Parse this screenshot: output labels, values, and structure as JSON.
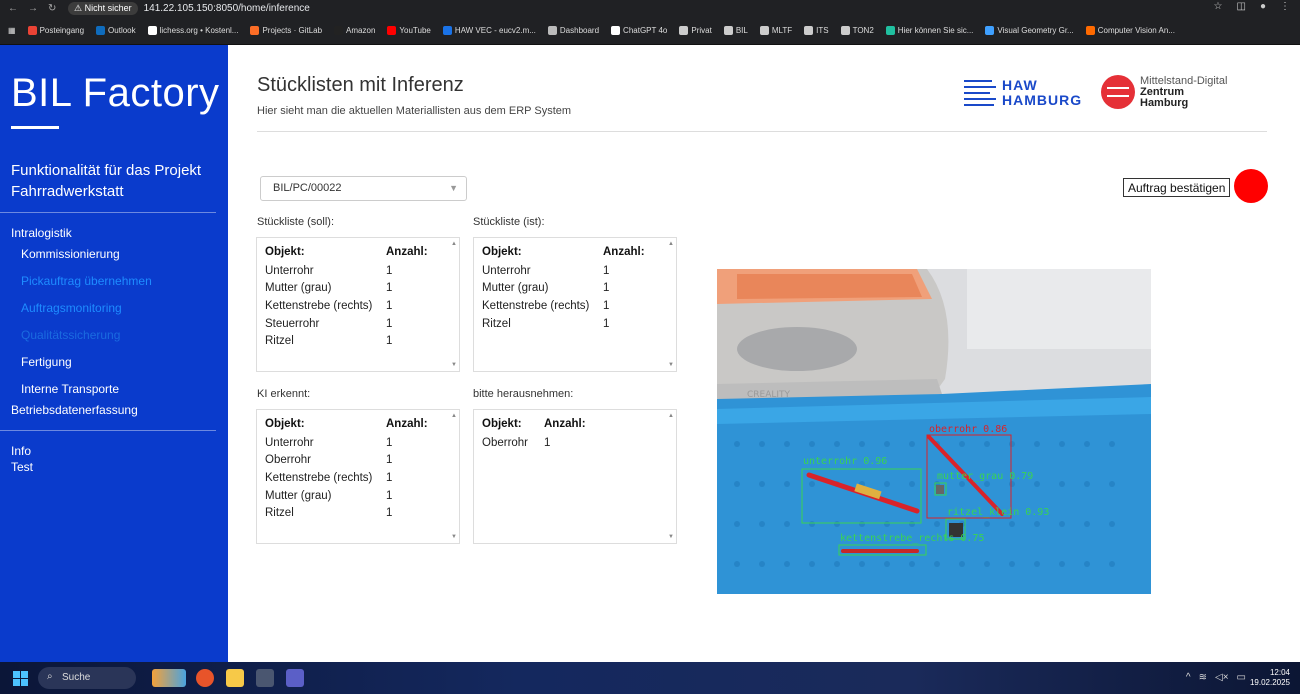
{
  "browser": {
    "security_badge": "⚠ Nicht sicher",
    "url": "141.22.105.150:8050/home/inference",
    "bookmarks": [
      "Posteingang",
      "Outlook",
      "lichess.org • Kostenl...",
      "Projects · GitLab",
      "Amazon",
      "YouTube",
      "HAW VEC - eucv2.m...",
      "Dashboard",
      "ChatGPT 4o",
      "Privat",
      "BIL",
      "MLTF",
      "ITS",
      "TON2",
      "Hier können Sie sic...",
      "Visual Geometry Gr...",
      "Computer Vision An..."
    ],
    "bookmark_colors": [
      "#ea4335",
      "#0f6cbd",
      "#ffffff",
      "#fc6d26",
      "#222222",
      "#ff0000",
      "#1a73e8",
      "#bbbbbb",
      "#ffffff",
      "#cccccc",
      "#cccccc",
      "#cccccc",
      "#cccccc",
      "#cccccc",
      "#20c0a0",
      "#3fa0ff",
      "#ff6a00"
    ]
  },
  "sidebar": {
    "brand": "BIL Factory",
    "project": "Funktionalität für das Projekt Fahrradwerkstatt",
    "items": [
      {
        "label": "Intralogistik",
        "level": 0,
        "style": "normal"
      },
      {
        "label": "Kommissionierung",
        "level": 1,
        "style": "normal"
      },
      {
        "label": "Pickauftrag übernehmen",
        "level": 1,
        "style": "dim"
      },
      {
        "label": "Auftragsmonitoring",
        "level": 1,
        "style": "dim"
      },
      {
        "label": "Qualitätssicherung",
        "level": 1,
        "style": "dim2"
      },
      {
        "label": "Fertigung",
        "level": 1,
        "style": "normal"
      },
      {
        "label": "Interne Transporte",
        "level": 1,
        "style": "normal"
      },
      {
        "label": "Betriebsdatenerfassung",
        "level": 0,
        "style": "normal"
      },
      {
        "label": "Info",
        "level": 0,
        "style": "normal"
      },
      {
        "label": "Test",
        "level": 0,
        "style": "normal"
      }
    ]
  },
  "header": {
    "title": "Stücklisten mit Inferenz",
    "subtitle": "Hier sieht man die aktuellen Materiallisten aus dem ERP System",
    "logo_haw_line1": "HAW",
    "logo_haw_line2": "HAMBURG",
    "logo_mdz_line1": "Mittelstand-Digital",
    "logo_mdz_line2": "Zentrum",
    "logo_mdz_line3": "Hamburg"
  },
  "controls": {
    "selected_list": "BIL/PC/00022",
    "confirm_label": "Auftrag bestätigen",
    "status_color": "#ff0000"
  },
  "panels": {
    "soll": {
      "label": "Stückliste (soll):",
      "headers": [
        "Objekt:",
        "Anzahl:"
      ],
      "rows": [
        [
          "Unterrohr",
          "1"
        ],
        [
          "Mutter (grau)",
          "1"
        ],
        [
          "Kettenstrebe (rechts)",
          "1"
        ],
        [
          "Steuerrohr",
          "1"
        ],
        [
          "Ritzel",
          "1"
        ]
      ]
    },
    "ist": {
      "label": "Stückliste (ist):",
      "headers": [
        "Objekt:",
        "Anzahl:"
      ],
      "rows": [
        [
          "Unterrohr",
          "1"
        ],
        [
          "Mutter (grau)",
          "1"
        ],
        [
          "Kettenstrebe (rechts)",
          "1"
        ],
        [
          "Ritzel",
          "1"
        ]
      ]
    },
    "ki": {
      "label": "KI erkennt:",
      "headers": [
        "Objekt:",
        "Anzahl:"
      ],
      "rows": [
        [
          "Unterrohr",
          "1"
        ],
        [
          "Oberrohr",
          "1"
        ],
        [
          "Kettenstrebe (rechts)",
          "1"
        ],
        [
          "Mutter (grau)",
          "1"
        ],
        [
          "Ritzel",
          "1"
        ]
      ]
    },
    "remove": {
      "label": "bitte herausnehmen:",
      "headers": [
        "Objekt:",
        "Anzahl:"
      ],
      "rows": [
        [
          "Oberrohr",
          "1"
        ]
      ]
    }
  },
  "camera": {
    "detections": [
      {
        "label": "unterrohr",
        "score": "0.96"
      },
      {
        "label": "oberrohr",
        "score": "0.86"
      },
      {
        "label": "mutter_grau",
        "score": "0.79"
      },
      {
        "label": "ritzel_klein",
        "score": "0.93"
      },
      {
        "label": "kettenstrebe_rechts",
        "score": "0.75"
      }
    ],
    "casing_text": "CREALITY"
  },
  "taskbar": {
    "search": "Suche",
    "time": "12:04",
    "date": "19.02.2025"
  }
}
